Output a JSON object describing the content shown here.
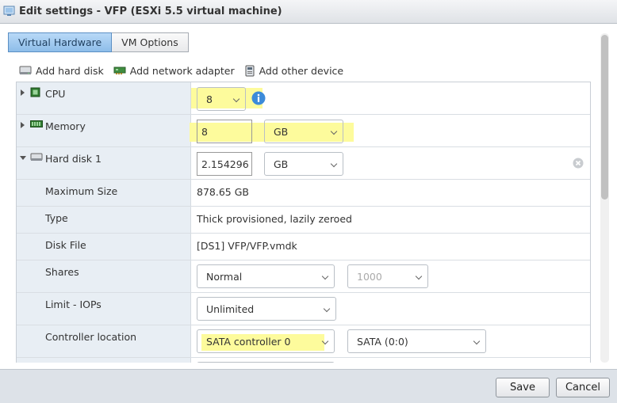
{
  "window": {
    "title": "Edit settings - VFP (ESXi 5.5 virtual machine)",
    "icon": "vm-settings-icon"
  },
  "tabs": [
    {
      "label": "Virtual Hardware",
      "active": true
    },
    {
      "label": "VM Options",
      "active": false
    }
  ],
  "toolbar": {
    "add_hard_disk": "Add hard disk",
    "add_network_adapter": "Add network adapter",
    "add_other_device": "Add other device"
  },
  "cpu": {
    "label": "CPU",
    "value": "8",
    "icon": "cpu-chip-icon"
  },
  "memory": {
    "label": "Memory",
    "value": "8",
    "unit": "GB",
    "icon": "memory-module-icon"
  },
  "hard_disk": {
    "label": "Hard disk 1",
    "icon": "hard-disk-icon",
    "size_value": "2.154296",
    "size_unit": "GB",
    "fields": {
      "maximum_size": {
        "label": "Maximum Size",
        "value": "878.65 GB"
      },
      "type": {
        "label": "Type",
        "value": "Thick provisioned, lazily zeroed"
      },
      "disk_file": {
        "label": "Disk File",
        "value": "[DS1] VFP/VFP.vmdk"
      },
      "shares": {
        "label": "Shares",
        "value": "Normal",
        "amount": "1000"
      },
      "limit_iops": {
        "label": "Limit - IOPs",
        "value": "Unlimited"
      },
      "controller_location": {
        "label": "Controller location",
        "controller": "SATA controller 0",
        "slot": "SATA (0:0)"
      }
    }
  },
  "highlight_color": "#fdfb9c",
  "active_tab_color": "#8dbde9",
  "buttons": {
    "save": "Save",
    "cancel": "Cancel"
  }
}
